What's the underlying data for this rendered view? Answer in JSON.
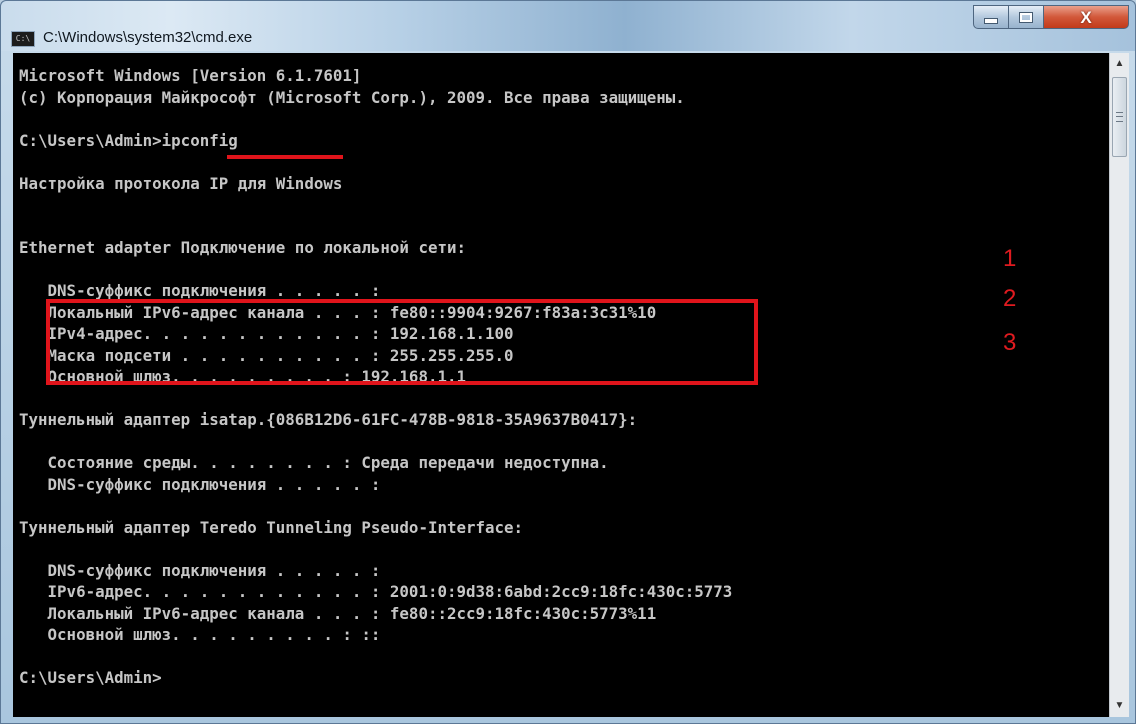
{
  "window": {
    "title": "C:\\Windows\\system32\\cmd.exe",
    "icon_label": "C:\\",
    "controls": {
      "minimize": "minimize-icon",
      "maximize": "maximize-icon",
      "close": "close-icon",
      "close_glyph": "X"
    }
  },
  "console": {
    "lines": [
      "Microsoft Windows [Version 6.1.7601]",
      "(c) Корпорация Майкрософт (Microsoft Corp.), 2009. Все права защищены.",
      "",
      "C:\\Users\\Admin>ipconfig",
      "",
      "Настройка протокола IP для Windows",
      "",
      "",
      "Ethernet adapter Подключение по локальной сети:",
      "",
      "   DNS-суффикс подключения . . . . . :",
      "   Локальный IPv6-адрес канала . . . : fe80::9904:9267:f83a:3c31%10",
      "   IPv4-адрес. . . . . . . . . . . . : 192.168.1.100",
      "   Маска подсети . . . . . . . . . . : 255.255.255.0",
      "   Основной шлюз. . . . . . . . . : 192.168.1.1",
      "",
      "Туннельный адаптер isatap.{086B12D6-61FC-478B-9818-35A9637B0417}:",
      "",
      "   Состояние среды. . . . . . . . : Среда передачи недоступна.",
      "   DNS-суффикс подключения . . . . . :",
      "",
      "Туннельный адаптер Teredo Tunneling Pseudo-Interface:",
      "",
      "   DNS-суффикс подключения . . . . . :",
      "   IPv6-адрес. . . . . . . . . . . . : 2001:0:9d38:6abd:2cc9:18fc:430c:5773",
      "   Локальный IPv6-адрес канала . . . : fe80::2cc9:18fc:430c:5773%11",
      "   Основной шлюз. . . . . . . . . : ::",
      "",
      "C:\\Users\\Admin>"
    ]
  },
  "annotations": {
    "numbers": [
      "1",
      "2",
      "3"
    ],
    "color": "#e0141b"
  },
  "scrollbar": {
    "up_glyph": "▲",
    "down_glyph": "▼"
  }
}
